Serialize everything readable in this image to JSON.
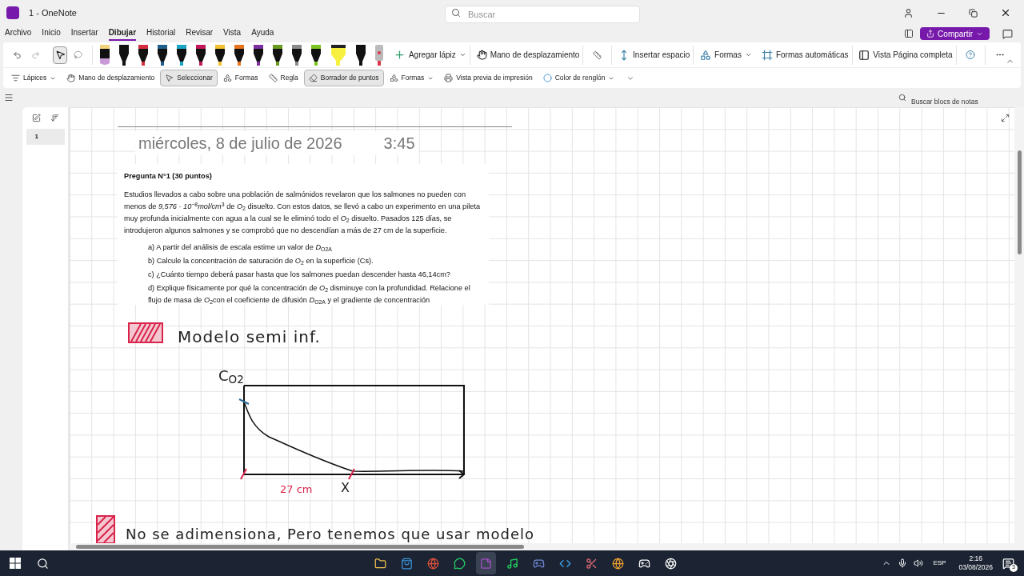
{
  "window": {
    "title": "1 - OneNote",
    "search_placeholder": "Buscar",
    "share_button": "Compartir"
  },
  "menu_tabs": [
    {
      "label": "Archivo",
      "selected": false
    },
    {
      "label": "Inicio",
      "selected": false
    },
    {
      "label": "Insertar",
      "selected": false
    },
    {
      "label": "Dibujar",
      "selected": true
    },
    {
      "label": "Historial",
      "selected": false
    },
    {
      "label": "Revisar",
      "selected": false
    },
    {
      "label": "Vista",
      "selected": false
    },
    {
      "label": "Ayuda",
      "selected": false
    }
  ],
  "ribbon": {
    "select_selected": true,
    "pens": [
      {
        "kind": "pencil",
        "color": "#c89ad6"
      },
      {
        "kind": "pen",
        "color": "#111111"
      },
      {
        "kind": "pen",
        "color": "#d32f3f"
      },
      {
        "kind": "pen",
        "color": "#1e5f8c"
      },
      {
        "kind": "pen",
        "color": "#1aa5c5"
      },
      {
        "kind": "pen",
        "color": "#c2185b"
      },
      {
        "kind": "pen",
        "color": "#f0c030"
      },
      {
        "kind": "pen",
        "color": "#e6731e"
      },
      {
        "kind": "pen",
        "color": "#7b2fa0"
      },
      {
        "kind": "pen",
        "color": "#6a9a1f"
      },
      {
        "kind": "pen",
        "color": "#8a8a8a"
      },
      {
        "kind": "pen",
        "color": "#7cc520"
      },
      {
        "kind": "highlighter",
        "color": "#f7f040"
      },
      {
        "kind": "pen",
        "color": "#111111"
      },
      {
        "kind": "laser",
        "color": "#d9374b"
      }
    ],
    "add_pen": "Agregar lápiz",
    "pan_hand": "Mano de desplazamiento",
    "insert_space": "Insertar espacio",
    "shapes": "Formas",
    "auto_shapes": "Formas automáticas",
    "full_page": "Vista Página completa"
  },
  "quick_bar": [
    {
      "label": "Lápices",
      "selected": false
    },
    {
      "label": "Mano de desplazamiento",
      "selected": false
    },
    {
      "label": "Seleccionar",
      "selected": true
    },
    {
      "label": "Formas",
      "selected": false
    },
    {
      "label": "Regla",
      "selected": false
    },
    {
      "label": "Borrador de puntos",
      "selected": true
    },
    {
      "label": "Formas",
      "selected": false
    },
    {
      "label": "Vista previa de impresión",
      "selected": false
    },
    {
      "label": "Color de renglón",
      "selected": false
    }
  ],
  "notebook_search_placeholder": "Buscar blocs de notas",
  "pages": [
    {
      "label": "1",
      "selected": true
    }
  ],
  "page": {
    "date": "miércoles, 8 de julio de 2026",
    "time": "3:45",
    "question": {
      "title": "Pregunta N°1 (30 puntos)",
      "paragraph": "Estudios llevados a cabo sobre una población de salmónidos revelaron que los salmones no pueden con menos de *9,576 · 10*$^{−8}$*mol/cm*$^{3}$ de *O*$_{2}$ disuelto. Con estos datos, se llevó a cabo un experimento en una pileta muy profunda inicialmente con agua a la cual se le eliminó todo el *O*$_{2}$ disuelto. Pasados 125 días, se introdujeron algunos salmones y se comprobó que no descendían a más de 27 cm de la superficie.",
      "items": [
        "a) A partir del análisis de escala estime un valor de *D*$_{O2A}$",
        "b) Calcule la concentración de saturación de *O*$_{2}$ en la superficie (Cs).",
        "c) ¿Cuánto tiempo deberá pasar hasta que los salmones puedan descender hasta 46,14cm?",
        "d) Explique físicamente por qué la concentración de *O*$_{2}$ disminuye con la profundidad. Relacione el flujo de masa de *O*$_{2}$con el coeficiente de difusión *D*$_{O2A}$ y el gradiente de concentración"
      ]
    },
    "notes": [
      {
        "text": "Modelo semi inf."
      },
      {
        "text": "No se adimensiona, Pero tenemos que usar modelo"
      }
    ],
    "graph": {
      "y_label": "C$_{O2}$",
      "distance_label": "27 cm",
      "x_label": "X"
    }
  },
  "taskbar": {
    "apps": [
      {
        "selected": false
      },
      {
        "selected": false
      },
      {
        "selected": false
      },
      {
        "selected": false
      },
      {
        "selected": true
      },
      {
        "selected": false
      },
      {
        "selected": false
      },
      {
        "selected": false
      },
      {
        "selected": false
      },
      {
        "selected": false
      },
      {
        "selected": false
      },
      {
        "selected": false
      }
    ],
    "language": "ESP",
    "time": "2:16",
    "date": "03/08/2026",
    "notifications": "3"
  }
}
